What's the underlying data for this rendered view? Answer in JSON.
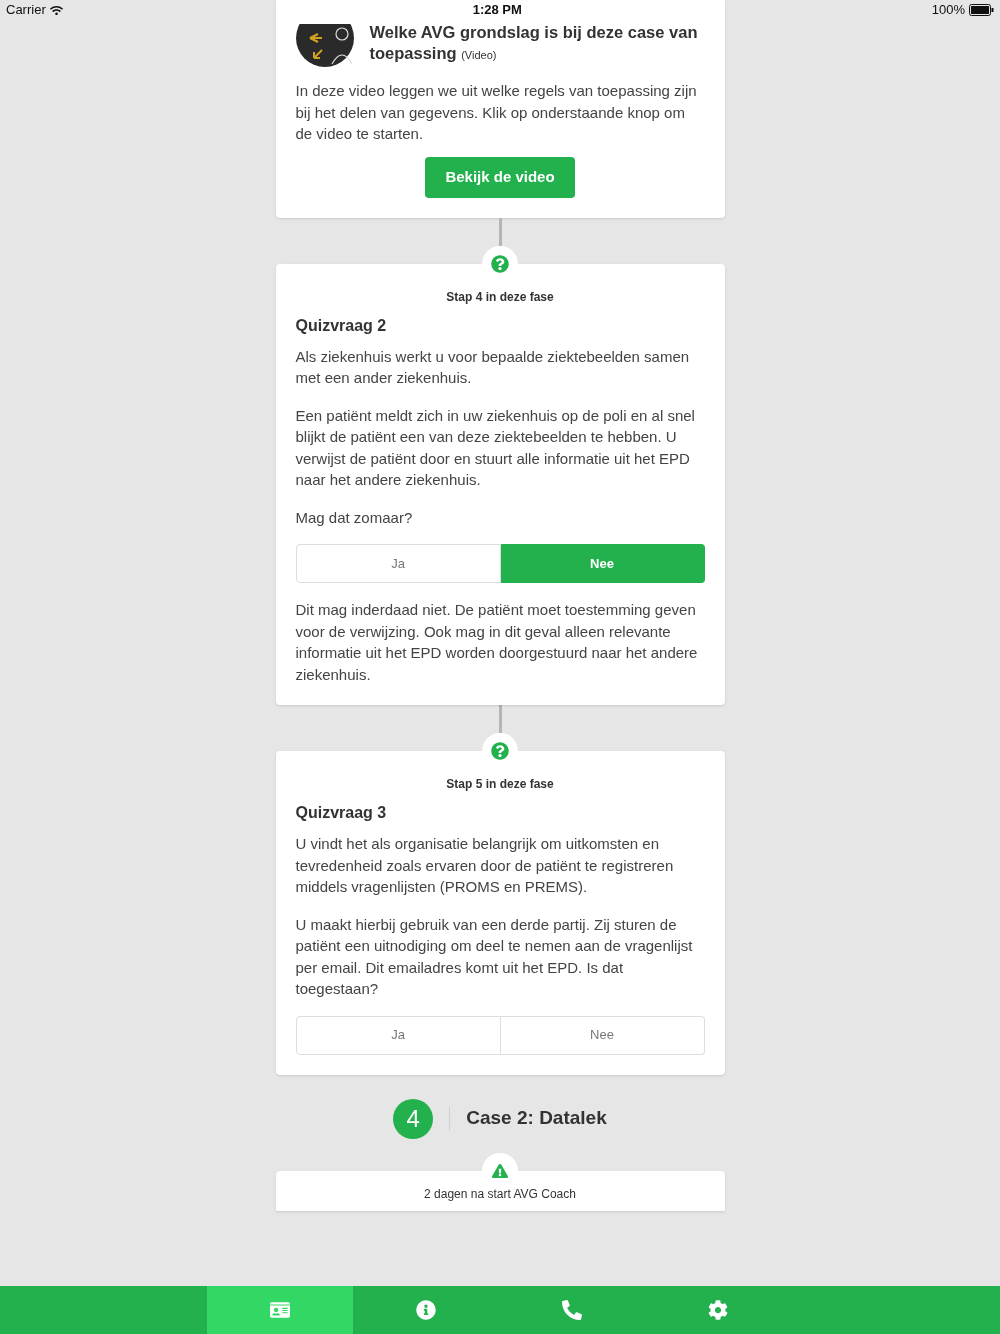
{
  "status_bar": {
    "carrier": "Carrier",
    "time": "1:28 PM",
    "battery": "100%"
  },
  "video_card": {
    "title": "Welke AVG grondslag is bij deze case van toepassing",
    "tag": "(Video)",
    "body": "In deze video leggen we uit welke regels van toepassing zijn bij het delen van gegevens. Klik op onderstaande knop om de video te starten.",
    "button": "Bekijk de video"
  },
  "steps": [
    {
      "kind": "quiz",
      "step": "Stap 4 in deze fase",
      "title": "Quizvraag 2",
      "paragraphs": [
        "Als ziekenhuis werkt u voor bepaalde ziektebeelden samen met een ander ziekenhuis.",
        "Een patiënt meldt zich in uw ziekenhuis op de poli en al snel blijkt de patiënt een van deze ziektebeelden te hebben. U verwijst de patiënt door en stuurt alle informatie uit het EPD naar het andere ziekenhuis.",
        "Mag dat zomaar?"
      ],
      "options": [
        {
          "label": "Ja",
          "selected": false
        },
        {
          "label": "Nee",
          "selected": true
        }
      ],
      "feedback": "Dit mag inderdaad niet. De patiënt moet toestemming geven voor de verwijzing. Ook mag in dit geval alleen relevante informatie uit het EPD worden doorgestuurd naar het andere ziekenhuis."
    },
    {
      "kind": "quiz",
      "step": "Stap 5 in deze fase",
      "title": "Quizvraag 3",
      "paragraphs": [
        "U vindt het als organisatie belangrijk om uitkomsten en tevredenheid zoals ervaren door de patiënt te registreren middels vragenlijsten (PROMS en PREMS).",
        "U maakt hierbij gebruik van een derde partij. Zij sturen de patiënt een uitnodiging om deel te nemen aan de vragenlijst per email. Dit emailadres komt uit het EPD. Is dat toegestaan?"
      ],
      "options": [
        {
          "label": "Ja",
          "selected": false
        },
        {
          "label": "Nee",
          "selected": false
        }
      ]
    }
  ],
  "phase": {
    "number": "4",
    "title": "Case 2: Datalek"
  },
  "next_card": {
    "step": "2 dagen na start AVG Coach"
  },
  "nav": [
    {
      "kind": "tasks",
      "selected": true
    },
    {
      "kind": "info",
      "selected": false
    },
    {
      "kind": "phone",
      "selected": false
    },
    {
      "kind": "settings",
      "selected": false
    }
  ]
}
